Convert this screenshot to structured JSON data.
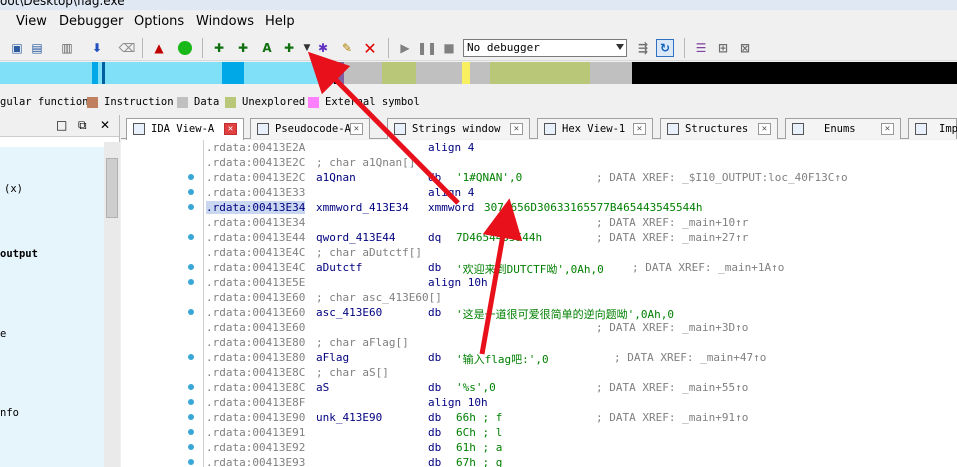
{
  "window": {
    "title": "oot\\Desktop\\flag.exe"
  },
  "menu": [
    "View",
    "Debugger",
    "Options",
    "Windows",
    "Help"
  ],
  "toolbar": {
    "debugger_select": "No debugger",
    "icons": [
      "open-icon",
      "save-icon",
      "db-icon",
      "print-icon",
      "jump-icon",
      "clear-icon",
      "graph-icon",
      "run-icon",
      "add-icon",
      "add-struct-icon",
      "add-text-icon",
      "add-enum-icon",
      "dropdown-icon",
      "star-icon",
      "edit-icon",
      "cancel-icon",
      "play-icon",
      "pause-icon",
      "stop-icon",
      "trace-icon",
      "step-icon",
      "list-icon",
      "tree-icon",
      "close-tree-icon"
    ]
  },
  "legend": [
    {
      "label": "gular function",
      "color": ""
    },
    {
      "label": "Instruction",
      "color": "#c08060"
    },
    {
      "label": "Data",
      "color": "#c0c0c0"
    },
    {
      "label": "Unexplored",
      "color": "#b8c878"
    },
    {
      "label": "External symbol",
      "color": "#ff80ff"
    }
  ],
  "left_panel": {
    "items": [
      "(x)",
      "output",
      "e",
      "nfo"
    ]
  },
  "tabs": [
    {
      "label": "IDA View-A",
      "active": true
    },
    {
      "label": "Pseudocode-A",
      "active": false
    },
    {
      "label": "Strings window",
      "active": false
    },
    {
      "label": "Hex View-1",
      "active": false
    },
    {
      "label": "Structures",
      "active": false
    },
    {
      "label": "Enums",
      "active": false
    },
    {
      "label": "Imp",
      "active": false
    }
  ],
  "code_lines": [
    {
      "addr": ".rdata:00413E2A",
      "label": "",
      "mnem": "align 4",
      "operand": "",
      "xref": "",
      "dot": false
    },
    {
      "addr": ".rdata:00413E2C",
      "label": "; char a1Qnan[]",
      "mnem": "",
      "operand": "",
      "xref": "",
      "dot": false
    },
    {
      "addr": ".rdata:00413E2C",
      "label": "a1Qnan",
      "mnem": "db",
      "operand": "'1#QNAN',0",
      "xref": "; DATA XREF: _$I10_OUTPUT:loc_40F13C↑o",
      "dot": true
    },
    {
      "addr": ".rdata:00413E33",
      "label": "",
      "mnem": "align 4",
      "operand": "",
      "xref": "",
      "dot": true
    },
    {
      "addr": ".rdata:00413E34",
      "label": "xmmword_413E34",
      "mnem": "xmmword",
      "operand": "3074656D30633165577B465443545544h",
      "xref": "",
      "dot": true,
      "sel": true
    },
    {
      "addr": ".rdata:00413E34",
      "label": "",
      "mnem": "",
      "operand": "",
      "xref": "; DATA XREF: _main+10↑r",
      "dot": false
    },
    {
      "addr": ".rdata:00413E44",
      "label": "qword_413E44",
      "mnem": "dq",
      "operand": "7D4654455544h",
      "xref": "; DATA XREF: _main+27↑r",
      "dot": true
    },
    {
      "addr": ".rdata:00413E4C",
      "label": "; char aDutctf[]",
      "mnem": "",
      "operand": "",
      "xref": "",
      "dot": false
    },
    {
      "addr": ".rdata:00413E4C",
      "label": "aDutctf",
      "mnem": "db",
      "operand": "'欢迎来到DUTCTF呦',0Ah,0",
      "xref": "; DATA XREF: _main+1A↑o",
      "dot": true
    },
    {
      "addr": ".rdata:00413E5E",
      "label": "",
      "mnem": "align 10h",
      "operand": "",
      "xref": "",
      "dot": true
    },
    {
      "addr": ".rdata:00413E60",
      "label": "; char asc_413E60[]",
      "mnem": "",
      "operand": "",
      "xref": "",
      "dot": false
    },
    {
      "addr": ".rdata:00413E60",
      "label": "asc_413E60",
      "mnem": "db",
      "operand": "'这是一道很可爱很简单的逆向题呦',0Ah,0",
      "xref": "",
      "dot": true
    },
    {
      "addr": ".rdata:00413E60",
      "label": "",
      "mnem": "",
      "operand": "",
      "xref": "; DATA XREF: _main+3D↑o",
      "dot": false
    },
    {
      "addr": ".rdata:00413E80",
      "label": "; char aFlag[]",
      "mnem": "",
      "operand": "",
      "xref": "",
      "dot": false
    },
    {
      "addr": ".rdata:00413E80",
      "label": "aFlag",
      "mnem": "db",
      "operand": "'输入flag吧:',0",
      "xref": "; DATA XREF: _main+47↑o",
      "dot": true
    },
    {
      "addr": ".rdata:00413E8C",
      "label": "; char aS[]",
      "mnem": "",
      "operand": "",
      "xref": "",
      "dot": false
    },
    {
      "addr": ".rdata:00413E8C",
      "label": "aS",
      "mnem": "db",
      "operand": "'%s',0",
      "xref": "; DATA XREF: _main+55↑o",
      "dot": true
    },
    {
      "addr": ".rdata:00413E8F",
      "label": "",
      "mnem": "align 10h",
      "operand": "",
      "xref": "",
      "dot": true
    },
    {
      "addr": ".rdata:00413E90",
      "label": "unk_413E90",
      "mnem": "db",
      "operand": "66h ; f",
      "xref": "; DATA XREF: _main+91↑o",
      "dot": true
    },
    {
      "addr": ".rdata:00413E91",
      "label": "",
      "mnem": "db",
      "operand": "6Ch ; l",
      "xref": "",
      "dot": true
    },
    {
      "addr": ".rdata:00413E92",
      "label": "",
      "mnem": "db",
      "operand": "61h ; a",
      "xref": "",
      "dot": true
    },
    {
      "addr": ".rdata:00413E93",
      "label": "",
      "mnem": "db",
      "operand": "67h ; g",
      "xref": "",
      "dot": true
    }
  ],
  "colors": {
    "arrow": "#e8101a",
    "nav_blue": "#00a8e8",
    "nav_cyan": "#80e0f8",
    "nav_olive": "#b8c878"
  }
}
